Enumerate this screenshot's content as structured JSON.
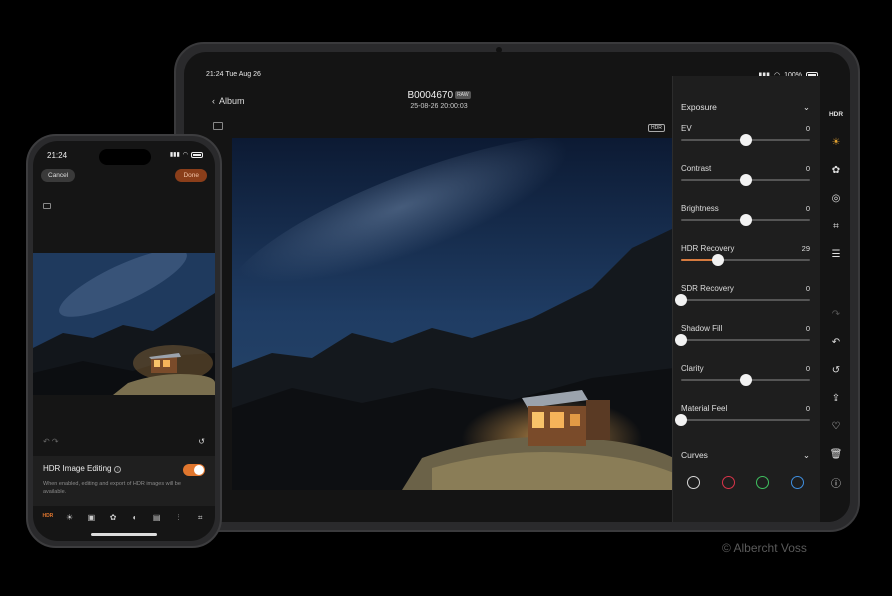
{
  "ipad": {
    "status_time": "21:24  Tue Aug 26",
    "status_right": "100%",
    "back_label": "Album",
    "file_name": "B0004670",
    "raw_badge": "RAW",
    "file_date": "25-08-26 20:00:03",
    "hdr_chip": "HDR",
    "panel": {
      "section_title": "Exposure",
      "adjustments": [
        {
          "label": "EV",
          "value": "0",
          "level": 0.5
        },
        {
          "label": "Contrast",
          "value": "0",
          "level": 0.5
        },
        {
          "label": "Brightness",
          "value": "0",
          "level": 0.5
        },
        {
          "label": "HDR Recovery",
          "value": "29",
          "level": 0.29,
          "accent": true
        },
        {
          "label": "SDR Recovery",
          "value": "0",
          "level": 0.0
        },
        {
          "label": "Shadow Fill",
          "value": "0",
          "level": 0.0
        },
        {
          "label": "Clarity",
          "value": "0",
          "level": 0.5
        },
        {
          "label": "Material Feel",
          "value": "0",
          "level": 0.0
        }
      ],
      "curves_title": "Curves",
      "curve_colors": [
        "#d8d8d8",
        "#d9344a",
        "#3fbf5f",
        "#3f8fe0"
      ]
    },
    "toolbar": {
      "hdr_label": "HDR",
      "icons": [
        "sun-icon",
        "color-circles-icon",
        "aperture-icon",
        "crop-icon",
        "list-icon",
        "redo-icon",
        "undo-icon",
        "reset-icon",
        "share-icon",
        "heart-icon",
        "trash-icon",
        "info-icon"
      ]
    }
  },
  "iphone": {
    "status_time": "21:24",
    "cancel_label": "Cancel",
    "done_label": "Done",
    "hdr_title": "HDR Image Editing",
    "hdr_desc": "When enabled, editing and export of HDR images will be available.",
    "hdr_enabled": true,
    "tool_active": "HDR",
    "accent": "#e0762e"
  },
  "credit": "© Albercht Voss"
}
